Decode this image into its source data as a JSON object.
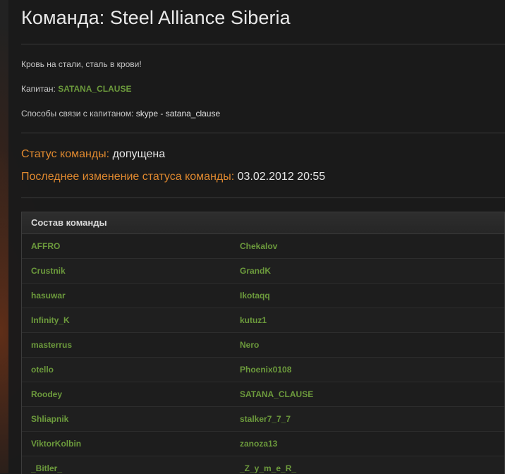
{
  "team": {
    "title": "Команда: Steel Alliance Siberia",
    "motto": "Кровь на стали, сталь в крови!",
    "captain_label": "Капитан:",
    "captain_name": "SATANA_CLAUSE",
    "contact_label": "Способы связи с капитаном:",
    "contact_value": "skype - satana_clause"
  },
  "status": {
    "label": "Статус команды:",
    "value": "допущена",
    "changed_label": "Последнее изменение статуса команды:",
    "changed_value": "03.02.2012 20:55"
  },
  "roster": {
    "header": "Состав команды",
    "rows": [
      [
        "AFFRO",
        "Chekalov"
      ],
      [
        "Crustnik",
        "GrandK"
      ],
      [
        "hasuwar",
        "Ikotaqq"
      ],
      [
        "Infinity_K",
        "kutuz1"
      ],
      [
        "masterrus",
        "Nero"
      ],
      [
        "otello",
        "Phoenix0108"
      ],
      [
        "Roodey",
        "SATANA_CLAUSE"
      ],
      [
        "Shliapnik",
        "stalker7_7_7"
      ],
      [
        "ViktorKolbin",
        "zanoza13"
      ],
      [
        "_Bitler_",
        "_Z_y_m_e_R_"
      ]
    ]
  },
  "colors": {
    "accent_orange": "#e0892f",
    "player_green": "#6c9a3c",
    "background": "#1c1c1c"
  }
}
